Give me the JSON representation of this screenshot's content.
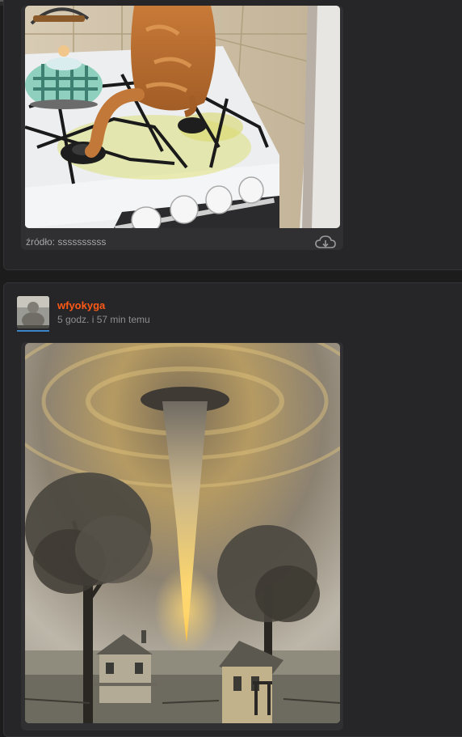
{
  "post1": {
    "image_subject": "cat-on-stove-photo",
    "source_label": "źródło: ssssssssss",
    "download_icon": "cloud-download-icon"
  },
  "post2": {
    "author": {
      "username": "wfyokyga",
      "time_ago": "5 godz. i 57 min temu"
    },
    "image_subject": "ufo-beam-farmhouse-illustration"
  },
  "colors": {
    "page_bg": "#1c1c1d",
    "card_bg": "#262628",
    "username": "#ff5917",
    "avatar_underline": "#3b86c8",
    "muted_text": "#a6a6a8"
  }
}
